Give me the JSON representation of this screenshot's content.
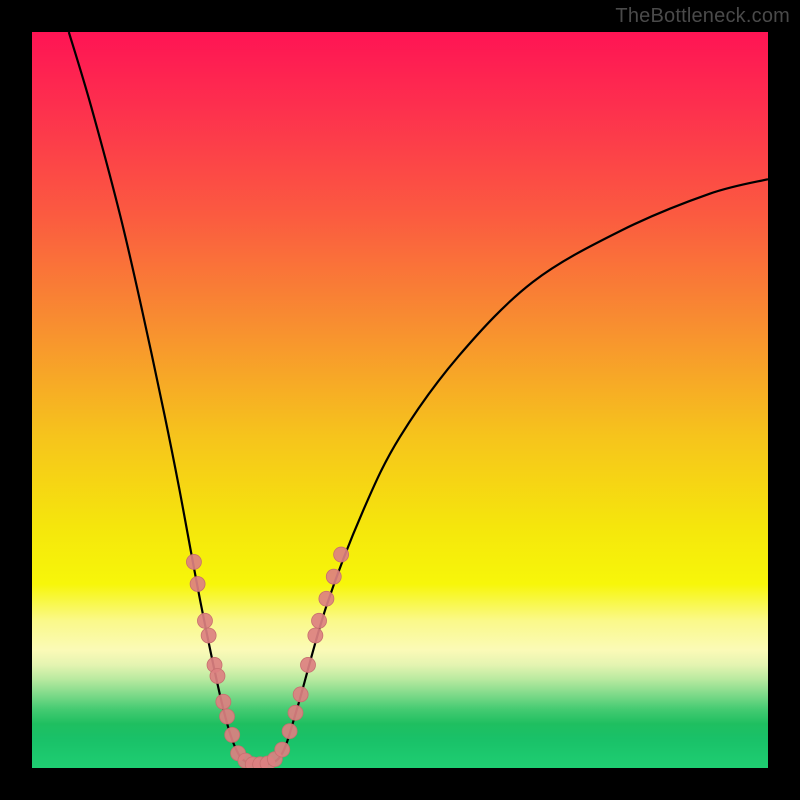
{
  "watermark": "TheBottleneck.com",
  "colors": {
    "frame": "#000000",
    "curve": "#000000",
    "marker_fill": "#dc8081",
    "marker_stroke": "#c76f6f"
  },
  "chart_data": {
    "type": "line",
    "title": "",
    "xlabel": "",
    "ylabel": "",
    "xlim": [
      0,
      100
    ],
    "ylim": [
      0,
      100
    ],
    "grid": false,
    "legend": false,
    "curve_description": "V-shaped bottleneck curve: steep descent from upper-left to a flat trough near x≈27-33 at y≈0, then a gentler rise toward the upper-right, asymptoting near y≈80.",
    "curve_samples": [
      {
        "x": 5.0,
        "y": 100.0
      },
      {
        "x": 8.0,
        "y": 90.0
      },
      {
        "x": 12.0,
        "y": 75.0
      },
      {
        "x": 15.0,
        "y": 62.0
      },
      {
        "x": 18.0,
        "y": 48.0
      },
      {
        "x": 20.0,
        "y": 38.0
      },
      {
        "x": 23.0,
        "y": 22.0
      },
      {
        "x": 26.0,
        "y": 8.0
      },
      {
        "x": 28.0,
        "y": 2.0
      },
      {
        "x": 30.0,
        "y": 0.5
      },
      {
        "x": 32.0,
        "y": 0.5
      },
      {
        "x": 34.0,
        "y": 2.0
      },
      {
        "x": 36.0,
        "y": 8.0
      },
      {
        "x": 40.0,
        "y": 22.0
      },
      {
        "x": 45.0,
        "y": 35.0
      },
      {
        "x": 50.0,
        "y": 45.0
      },
      {
        "x": 58.0,
        "y": 56.0
      },
      {
        "x": 68.0,
        "y": 66.0
      },
      {
        "x": 80.0,
        "y": 73.0
      },
      {
        "x": 92.0,
        "y": 78.0
      },
      {
        "x": 100.0,
        "y": 80.0
      }
    ],
    "markers_description": "Salmon-colored circular markers clustered densely on both sides of the trough (the lower portion of each arm).",
    "marker_points": [
      {
        "x": 22.0,
        "y": 28.0
      },
      {
        "x": 22.5,
        "y": 25.0
      },
      {
        "x": 23.5,
        "y": 20.0
      },
      {
        "x": 24.0,
        "y": 18.0
      },
      {
        "x": 24.8,
        "y": 14.0
      },
      {
        "x": 25.2,
        "y": 12.5
      },
      {
        "x": 26.0,
        "y": 9.0
      },
      {
        "x": 26.5,
        "y": 7.0
      },
      {
        "x": 27.2,
        "y": 4.5
      },
      {
        "x": 28.0,
        "y": 2.0
      },
      {
        "x": 29.0,
        "y": 1.0
      },
      {
        "x": 30.0,
        "y": 0.5
      },
      {
        "x": 31.0,
        "y": 0.5
      },
      {
        "x": 32.0,
        "y": 0.6
      },
      {
        "x": 33.0,
        "y": 1.2
      },
      {
        "x": 34.0,
        "y": 2.5
      },
      {
        "x": 35.0,
        "y": 5.0
      },
      {
        "x": 35.8,
        "y": 7.5
      },
      {
        "x": 36.5,
        "y": 10.0
      },
      {
        "x": 37.5,
        "y": 14.0
      },
      {
        "x": 38.5,
        "y": 18.0
      },
      {
        "x": 39.0,
        "y": 20.0
      },
      {
        "x": 40.0,
        "y": 23.0
      },
      {
        "x": 41.0,
        "y": 26.0
      },
      {
        "x": 42.0,
        "y": 29.0
      }
    ]
  }
}
